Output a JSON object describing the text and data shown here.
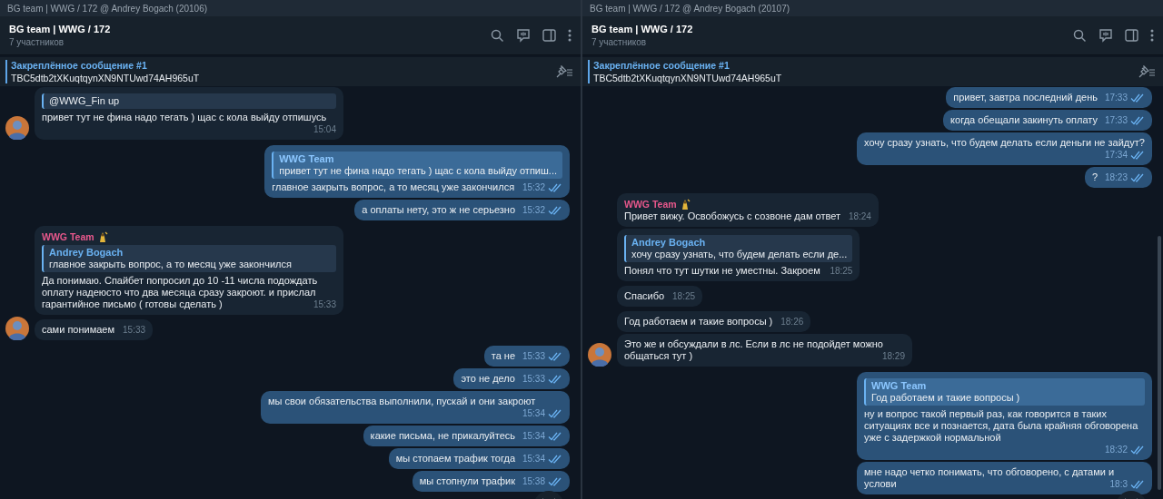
{
  "panes": [
    {
      "window_title": "BG team | WWG / 172 @ Andrey Bogach (20106)",
      "chat": {
        "title": "BG team | WWG / 172",
        "subtitle": "7 участников"
      },
      "pinned": {
        "label": "Закреплённое сообщение #1",
        "text": "TBC5dtb2tXKuqtqynXN9NTUwd74AH965uT"
      },
      "messages": [
        {
          "kind": "in",
          "avatar": true,
          "reply": {
            "text": "@WWG_Fin up"
          },
          "text": "привет тут не фина надо тегать ) щас с кола выйду отпишусь",
          "time": "15:04"
        },
        {
          "kind": "out",
          "read": true,
          "reply": {
            "name": "WWG Team",
            "text": "привет тут не фина надо тегать ) щас с кола выйду отпиш..."
          },
          "text": "главное закрыть вопрос, а то месяц уже закончился",
          "time": "15:32"
        },
        {
          "kind": "out",
          "read": true,
          "text": "а оплаты нету, это ж не серьезно",
          "time": "15:32"
        },
        {
          "kind": "in",
          "avatar": false,
          "sender": {
            "name": "WWG Team",
            "color": "#e8588c"
          },
          "reply": {
            "name": "Andrey Bogach",
            "text": "главное закрыть вопрос, а то месяц уже закончился"
          },
          "text": "Да понимаю. Спайбет попросил до 10 -11 числа подождать оплату надеюсто что два месяца сразу закроют. и прислал гарантийное письмо ( готовы сделать )",
          "time": "15:33"
        },
        {
          "kind": "in",
          "avatar": true,
          "text": "сами понимаем",
          "time": "15:33"
        },
        {
          "kind": "out",
          "read": true,
          "text": "та не",
          "time": "15:33"
        },
        {
          "kind": "out",
          "read": true,
          "text": "это не дело",
          "time": "15:33"
        },
        {
          "kind": "out",
          "read": true,
          "text": "мы свои обязательства выполнили, пускай и они закроют",
          "time": "15:34"
        },
        {
          "kind": "out",
          "read": true,
          "text": "какие письма, не прикалуйтесь",
          "time": "15:34"
        },
        {
          "kind": "out",
          "read": true,
          "text": "мы стопаем трафик тогда",
          "time": "15:34"
        },
        {
          "kind": "out",
          "read": true,
          "text": "мы стопнули трафик",
          "time": "15:38"
        }
      ]
    },
    {
      "window_title": "BG team | WWG / 172 @ Andrey Bogach (20107)",
      "chat": {
        "title": "BG team | WWG / 172",
        "subtitle": "7 участников"
      },
      "pinned": {
        "label": "Закреплённое сообщение #1",
        "text": "TBC5dtb2tXKuqtqynXN9NTUwd74AH965uT"
      },
      "messages": [
        {
          "kind": "out",
          "read": true,
          "text": "привет, завтра последний день",
          "time": "17:33"
        },
        {
          "kind": "out",
          "read": true,
          "text": "когда обещали закинуть оплату",
          "time": "17:33"
        },
        {
          "kind": "out",
          "read": true,
          "text": "хочу сразу узнать, что будем делать если деньги не зайдут?",
          "time": "17:34"
        },
        {
          "kind": "out",
          "read": true,
          "text": "?",
          "time": "18:23"
        },
        {
          "kind": "in",
          "avatar": false,
          "sender": {
            "name": "WWG Team",
            "color": "#e8588c"
          },
          "text": "Привет вижу. Освобожусь с созвоне дам ответ",
          "time": "18:24"
        },
        {
          "kind": "in",
          "avatar": false,
          "reply": {
            "name": "Andrey Bogach",
            "text": "хочу сразу узнать, что будем делать если де..."
          },
          "text": "Понял что тут шутки не уместны. Закроем",
          "time": "18:25"
        },
        {
          "kind": "in",
          "avatar": false,
          "text": "Спасибо",
          "time": "18:25"
        },
        {
          "kind": "in",
          "avatar": false,
          "text": "Год работаем и такие вопросы )",
          "time": "18:26"
        },
        {
          "kind": "in",
          "avatar": true,
          "text": "Это же и обсуждали в лс. Если в лс не подойдет можно общаться тут )",
          "time": "18:29"
        },
        {
          "kind": "out",
          "read": true,
          "reply": {
            "name": "WWG Team",
            "text": "Год работаем и такие вопросы )"
          },
          "text": "ну и вопрос такой первый раз, как говорится в таких ситуациях все и познается, дата была крайняя обговорена уже с задержкой нормальной",
          "time": "18:32"
        },
        {
          "kind": "out",
          "read": true,
          "text": "мне надо четко понимать, что обговорено, с датами и услови",
          "time": "18:3"
        }
      ]
    }
  ]
}
